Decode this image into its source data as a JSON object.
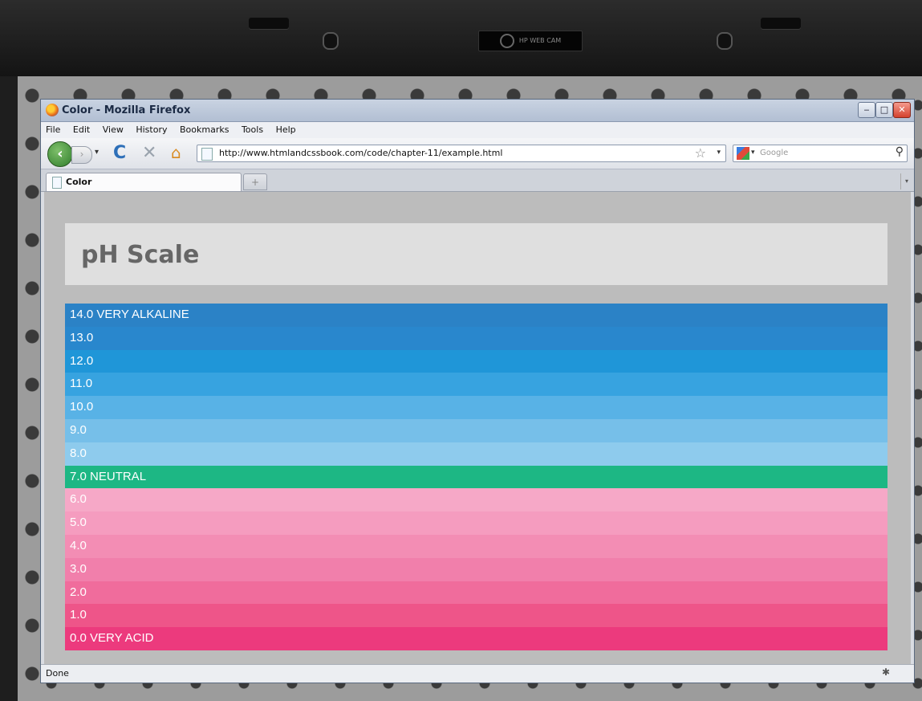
{
  "window": {
    "title": "Color - Mozilla Firefox",
    "minimize": "‒",
    "maximize": "□",
    "close": "✕"
  },
  "menu": [
    "File",
    "Edit",
    "View",
    "History",
    "Bookmarks",
    "Tools",
    "Help"
  ],
  "navigation": {
    "back": "‹",
    "forward": "›",
    "dropdown": "▾",
    "reload": "C",
    "stop": "✕",
    "home": "⌂",
    "url": "http://www.htmlandcssbook.com/code/chapter-11/example.html",
    "star": "☆",
    "search_placeholder": "Google",
    "magnify": "⚲"
  },
  "tabs": {
    "active_label": "Color",
    "new_tab": "+",
    "list_dropdown": "▾"
  },
  "page": {
    "title": "pH Scale",
    "rows": [
      {
        "label": "14.0 VERY ALKALINE",
        "color": "#2b82c6"
      },
      {
        "label": "13.0",
        "color": "#2987cd"
      },
      {
        "label": "12.0",
        "color": "#1f96d8"
      },
      {
        "label": "11.0",
        "color": "#37a3e0"
      },
      {
        "label": "10.0",
        "color": "#58b2e6"
      },
      {
        "label": "9.0",
        "color": "#76bfe9"
      },
      {
        "label": "8.0",
        "color": "#8ecbed"
      },
      {
        "label": "7.0 NEUTRAL",
        "color": "#1db784"
      },
      {
        "label": "6.0",
        "color": "#f6a8c7"
      },
      {
        "label": "5.0",
        "color": "#f59cbf"
      },
      {
        "label": "4.0",
        "color": "#f38db4"
      },
      {
        "label": "3.0",
        "color": "#f17fab"
      },
      {
        "label": "2.0",
        "color": "#f06c9c"
      },
      {
        "label": "1.0",
        "color": "#ee5589"
      },
      {
        "label": "0.0 VERY ACID",
        "color": "#ec3a7d"
      }
    ]
  },
  "status": {
    "text": "Done"
  },
  "webcam_label": "HP WEB CAM"
}
